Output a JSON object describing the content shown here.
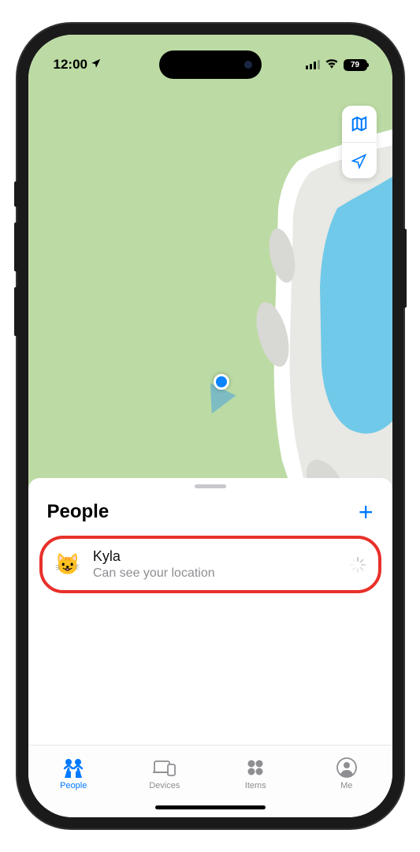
{
  "status": {
    "time": "12:00",
    "battery": "79"
  },
  "sheet": {
    "title": "People",
    "add_label": "+"
  },
  "person": {
    "avatar": "😺",
    "name": "Kyla",
    "subtitle": "Can see your location"
  },
  "tabs": {
    "people": "People",
    "devices": "Devices",
    "items": "Items",
    "me": "Me"
  }
}
